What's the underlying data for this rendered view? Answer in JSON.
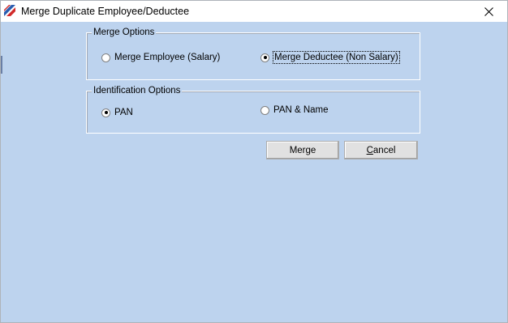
{
  "window": {
    "title": "Merge Duplicate Employee/Deductee",
    "close_glyph": "✕"
  },
  "merge_options": {
    "legend": "Merge Options",
    "employee_label": "Merge Employee (Salary)",
    "employee_checked": false,
    "deductee_label": "Merge Deductee (Non Salary)",
    "deductee_checked": true
  },
  "identification_options": {
    "legend": "Identification Options",
    "pan_label": "PAN",
    "pan_checked": true,
    "pan_name_label": "PAN & Name",
    "pan_name_checked": false
  },
  "buttons": {
    "merge_label": "Merge",
    "cancel_label": "Cancel"
  },
  "colors": {
    "client_background": "#bdd3ee",
    "titlebar_background": "#ffffff",
    "button_face": "#e1e1e1"
  },
  "icons": {
    "app": "app-logo-icon",
    "close": "close-icon"
  }
}
